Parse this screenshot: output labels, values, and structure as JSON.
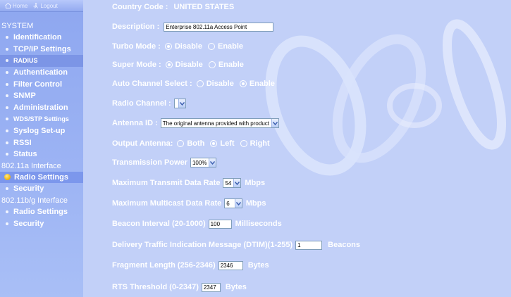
{
  "topbar": {
    "home_label": "Home",
    "logout_label": "Logout"
  },
  "sidebar": {
    "system_title": "SYSTEM",
    "system_items": [
      "Identification",
      "TCP/IP Settings",
      "RADIUS",
      "Authentication",
      "Filter Control",
      "SNMP",
      "Administration",
      "WDS/STP Settings",
      "Syslog Set-up",
      "RSSI",
      "Status"
    ],
    "iface_a_title": "802.11a Interface",
    "iface_a_items": [
      "Radio Settings",
      "Security"
    ],
    "iface_bg_title": "802.11b/g Interface",
    "iface_bg_items": [
      "Radio Settings",
      "Security"
    ]
  },
  "form": {
    "country_label": "Country Code :",
    "country_value": "UNITED STATES",
    "description_label": "Description :",
    "description_value": "Enterprise 802.11a Access Point",
    "turbo_label": "Turbo Mode :",
    "turbo_options": [
      "Disable",
      "Enable"
    ],
    "turbo_selected": "Disable",
    "super_label": "Super Mode :",
    "super_options": [
      "Disable",
      "Enable"
    ],
    "super_selected": "Disable",
    "autochan_label": "Auto Channel Select :",
    "autochan_options": [
      "Disable",
      "Enable"
    ],
    "autochan_selected": "Enable",
    "radio_channel_label": "Radio Channel :",
    "radio_channel_value": "",
    "antenna_id_label": "Antenna ID :",
    "antenna_id_value": "The original antenna provided with product",
    "output_antenna_label": "Output Antenna:",
    "output_antenna_options": [
      "Both",
      "Left",
      "Right"
    ],
    "output_antenna_selected": "Left",
    "tx_power_label": "Transmission Power",
    "tx_power_value": "100%",
    "max_tx_rate_label": "Maximum Transmit Data Rate",
    "max_tx_rate_value": "54",
    "max_tx_rate_unit": "Mbps",
    "max_mc_rate_label": "Maximum Multicast Data Rate",
    "max_mc_rate_value": "6",
    "max_mc_rate_unit": "Mbps",
    "beacon_label": "Beacon Interval (20-1000)",
    "beacon_value": "100",
    "beacon_unit": "Milliseconds",
    "dtim_label": "Delivery Traffic Indication Message (DTIM)(1-255)",
    "dtim_value": "1",
    "dtim_unit": "Beacons",
    "frag_label": "Fragment Length (256-2346)",
    "frag_value": "2346",
    "frag_unit": "Bytes",
    "rts_label": "RTS Threshold (0-2347)",
    "rts_value": "2347",
    "rts_unit": "Bytes"
  }
}
